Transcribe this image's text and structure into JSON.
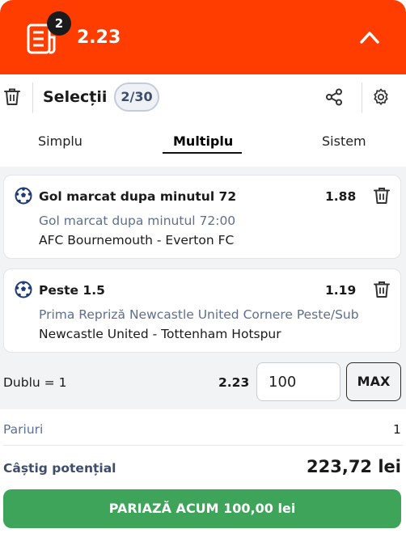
{
  "header": {
    "badge_count": "2",
    "total_odds": "2.23"
  },
  "toolbar": {
    "title": "Selecții",
    "selection_count": "2/30"
  },
  "tabs": [
    {
      "label": "Simplu",
      "active": false
    },
    {
      "label": "Multiplu",
      "active": true
    },
    {
      "label": "Sistem",
      "active": false
    }
  ],
  "selections": [
    {
      "name": "Gol marcat dupa minutul 72",
      "odds": "1.88",
      "market": "Gol marcat dupa minutul 72:00",
      "event": "AFC Bournemouth - Everton FC"
    },
    {
      "name": "Peste 1.5",
      "odds": "1.19",
      "market": "Prima Repriză Newcastle United Cornere Peste/Sub",
      "event": "Newcastle United - Tottenham Hotspur"
    }
  ],
  "combo": {
    "label": "Dublu = 1",
    "odds": "2.23",
    "stake_value": "100",
    "max_label": "MAX"
  },
  "footer": {
    "bets_label": "Pariuri",
    "bets_value": "1",
    "potential_win_label": "Câștig potențial",
    "potential_win_value": "223,72 lei",
    "bet_button_label": "PARIAZĂ ACUM 100,00 lei"
  },
  "icons": {
    "slip": "bet-slip-icon",
    "collapse": "chevron-up-icon",
    "delete": "trash-icon",
    "share": "share-icon",
    "settings": "gear-icon",
    "sport": "soccer-ball-icon"
  },
  "colors": {
    "brand": "#ff3d00",
    "bet_button": "#3da45a",
    "muted_text": "#5d6f8f"
  }
}
